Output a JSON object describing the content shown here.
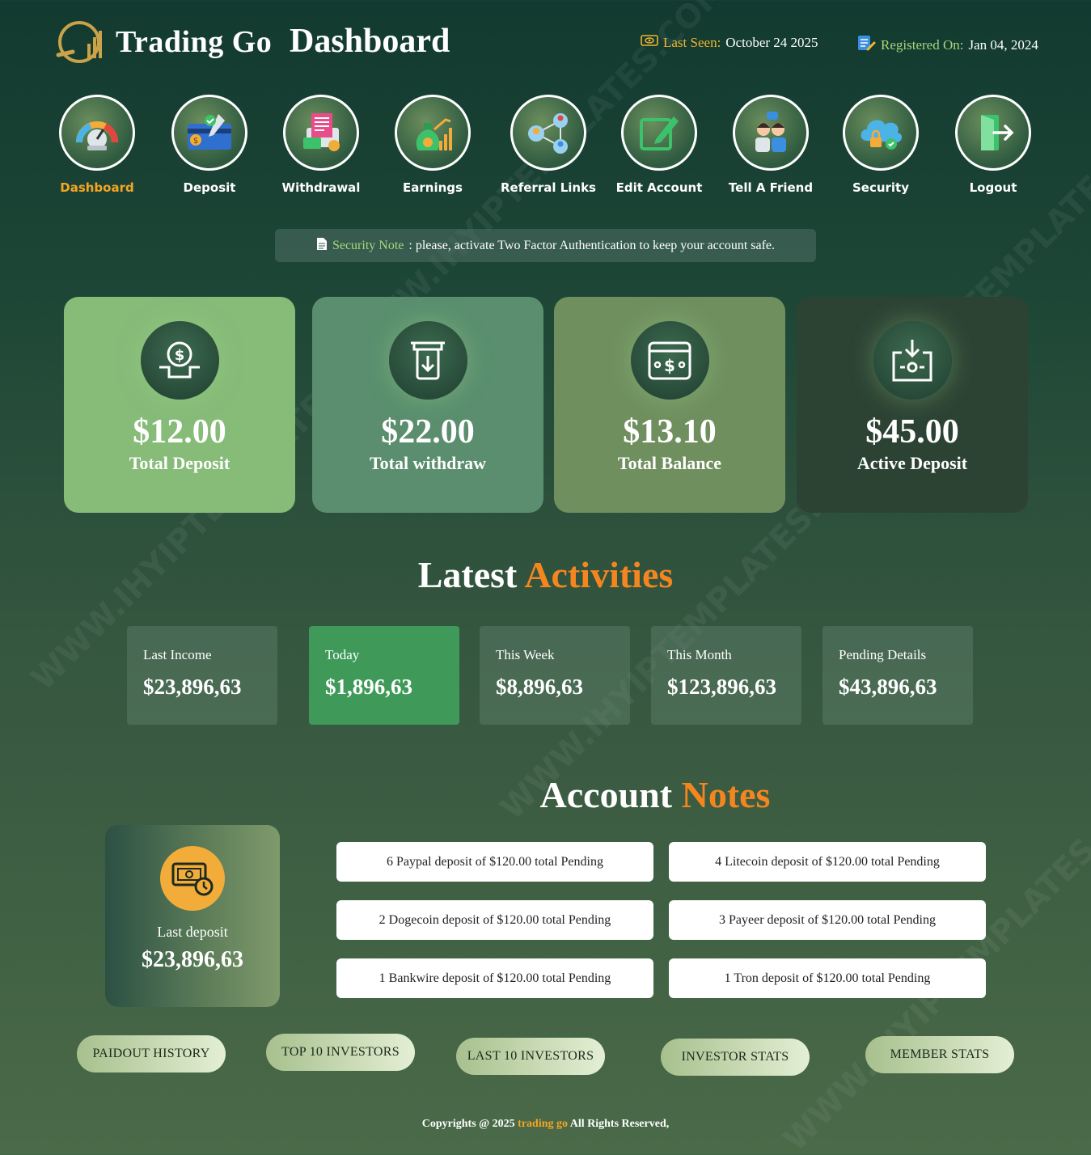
{
  "header": {
    "brand": "Trading Go",
    "page_title": "Dashboard",
    "last_seen_label": "Last Seen:",
    "last_seen_value": "October 24 2025",
    "registered_label": "Registered On:",
    "registered_value": "Jan 04, 2024"
  },
  "nav": [
    {
      "label": "Dashboard",
      "icon": "gauge-icon",
      "active": true
    },
    {
      "label": "Deposit",
      "icon": "card-payment-icon"
    },
    {
      "label": "Withdrawal",
      "icon": "receipt-cash-icon"
    },
    {
      "label": "Earnings",
      "icon": "money-bag-growth-icon"
    },
    {
      "label": "Referral Links",
      "icon": "network-people-icon"
    },
    {
      "label": "Edit Account",
      "icon": "edit-pencil-icon"
    },
    {
      "label": "Tell A Friend",
      "icon": "friends-chat-icon"
    },
    {
      "label": "Security",
      "icon": "cloud-lock-icon"
    },
    {
      "label": "Logout",
      "icon": "exit-door-icon"
    }
  ],
  "security_note": {
    "label": "Security Note",
    "text": ": please, activate Two Factor Authentication to keep your account safe."
  },
  "stats": [
    {
      "amount": "$12.00",
      "label": "Total Deposit",
      "icon": "cash-hand-icon"
    },
    {
      "amount": "$22.00",
      "label": "Total withdraw",
      "icon": "withdraw-slot-icon"
    },
    {
      "amount": "$13.10",
      "label": "Total Balance",
      "icon": "dollar-card-icon"
    },
    {
      "amount": "$45.00",
      "label": "Active Deposit",
      "icon": "download-wallet-icon"
    }
  ],
  "activities": {
    "title_a": "Latest",
    "title_b": "Activities",
    "items": [
      {
        "label": "Last Income",
        "value": "$23,896,63"
      },
      {
        "label": "Today",
        "value": "$1,896,63"
      },
      {
        "label": "This Week",
        "value": "$8,896,63"
      },
      {
        "label": "This Month",
        "value": "$123,896,63"
      },
      {
        "label": "Pending Details",
        "value": "$43,896,63"
      }
    ]
  },
  "account_notes": {
    "title_a": "Account",
    "title_b": "Notes",
    "last_deposit_label": "Last deposit",
    "last_deposit_value": "$23,896,63",
    "notes": [
      "6 Paypal deposit of $120.00 total Pending",
      "4 Litecoin deposit of $120.00 total Pending",
      "2 Dogecoin deposit of $120.00 total Pending",
      "3 Payeer deposit of $120.00 total Pending",
      "1 Bankwire deposit of $120.00 total Pending",
      "1 Tron deposit of $120.00 total Pending"
    ]
  },
  "buttons": [
    "PAIDOUT HISTORY",
    "TOP 10 INVESTORS",
    "LAST 10 INVESTORS",
    "INVESTOR STATS",
    "MEMBER STATS"
  ],
  "footer": {
    "pre": "Copyrights @ 2025",
    "brand": "trading go",
    "post": "All Rights Reserved,"
  },
  "watermark": "WWW.IHYIPTEMPLATES.COM",
  "colors": {
    "accent_orange": "#f5861f",
    "accent_green": "#a9d67a",
    "gold": "#f3b431"
  }
}
